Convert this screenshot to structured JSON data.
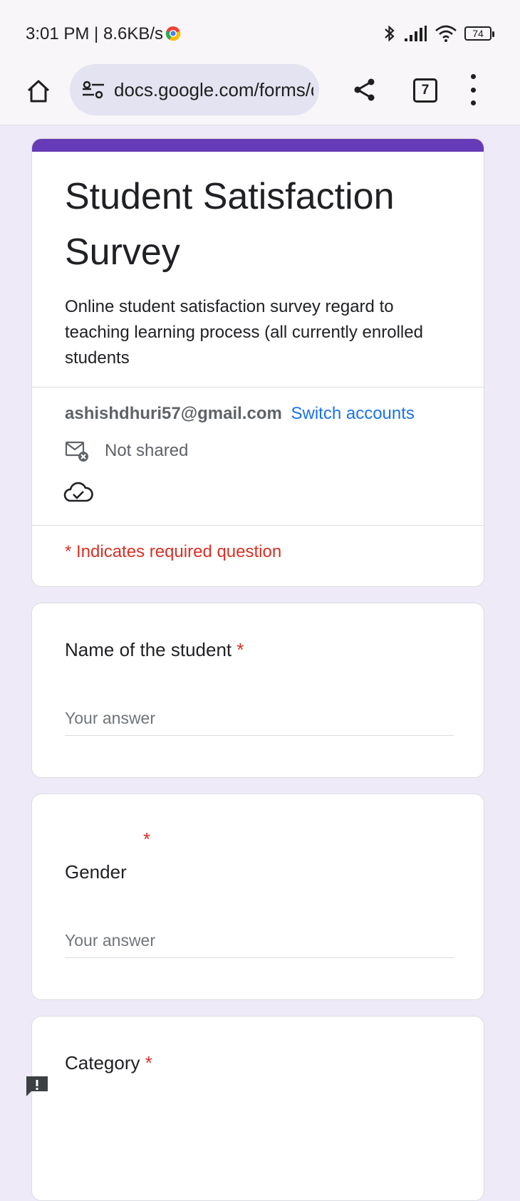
{
  "status_bar": {
    "time_speed": "3:01 PM | 8.6KB/s",
    "battery": "74"
  },
  "toolbar": {
    "url": "docs.google.com/forms/d",
    "tab_count": "7"
  },
  "form": {
    "accent_color": "#673ab7",
    "title": "Student Satisfaction Survey",
    "description": "Online student satisfaction survey regard to teaching learning process (all currently enrolled students",
    "account_email": "ashishdhuri57@gmail.com",
    "switch_accounts": "Switch accounts",
    "not_shared": "Not shared",
    "required_note": "* Indicates required question"
  },
  "questions": [
    {
      "title": "Name of the student",
      "required_mark": "*",
      "placeholder": "Your answer"
    },
    {
      "title": "Gender",
      "required_mark": "*",
      "placeholder": "Your answer"
    },
    {
      "title": "Category",
      "required_mark": "*"
    }
  ],
  "icons": {
    "home": "home-icon",
    "site_settings": "tune-icon",
    "share": "share-icon",
    "menu": "more-vert-icon",
    "not_shared": "mail-off-icon",
    "saved": "cloud-check-icon",
    "feedback": "feedback-icon"
  }
}
